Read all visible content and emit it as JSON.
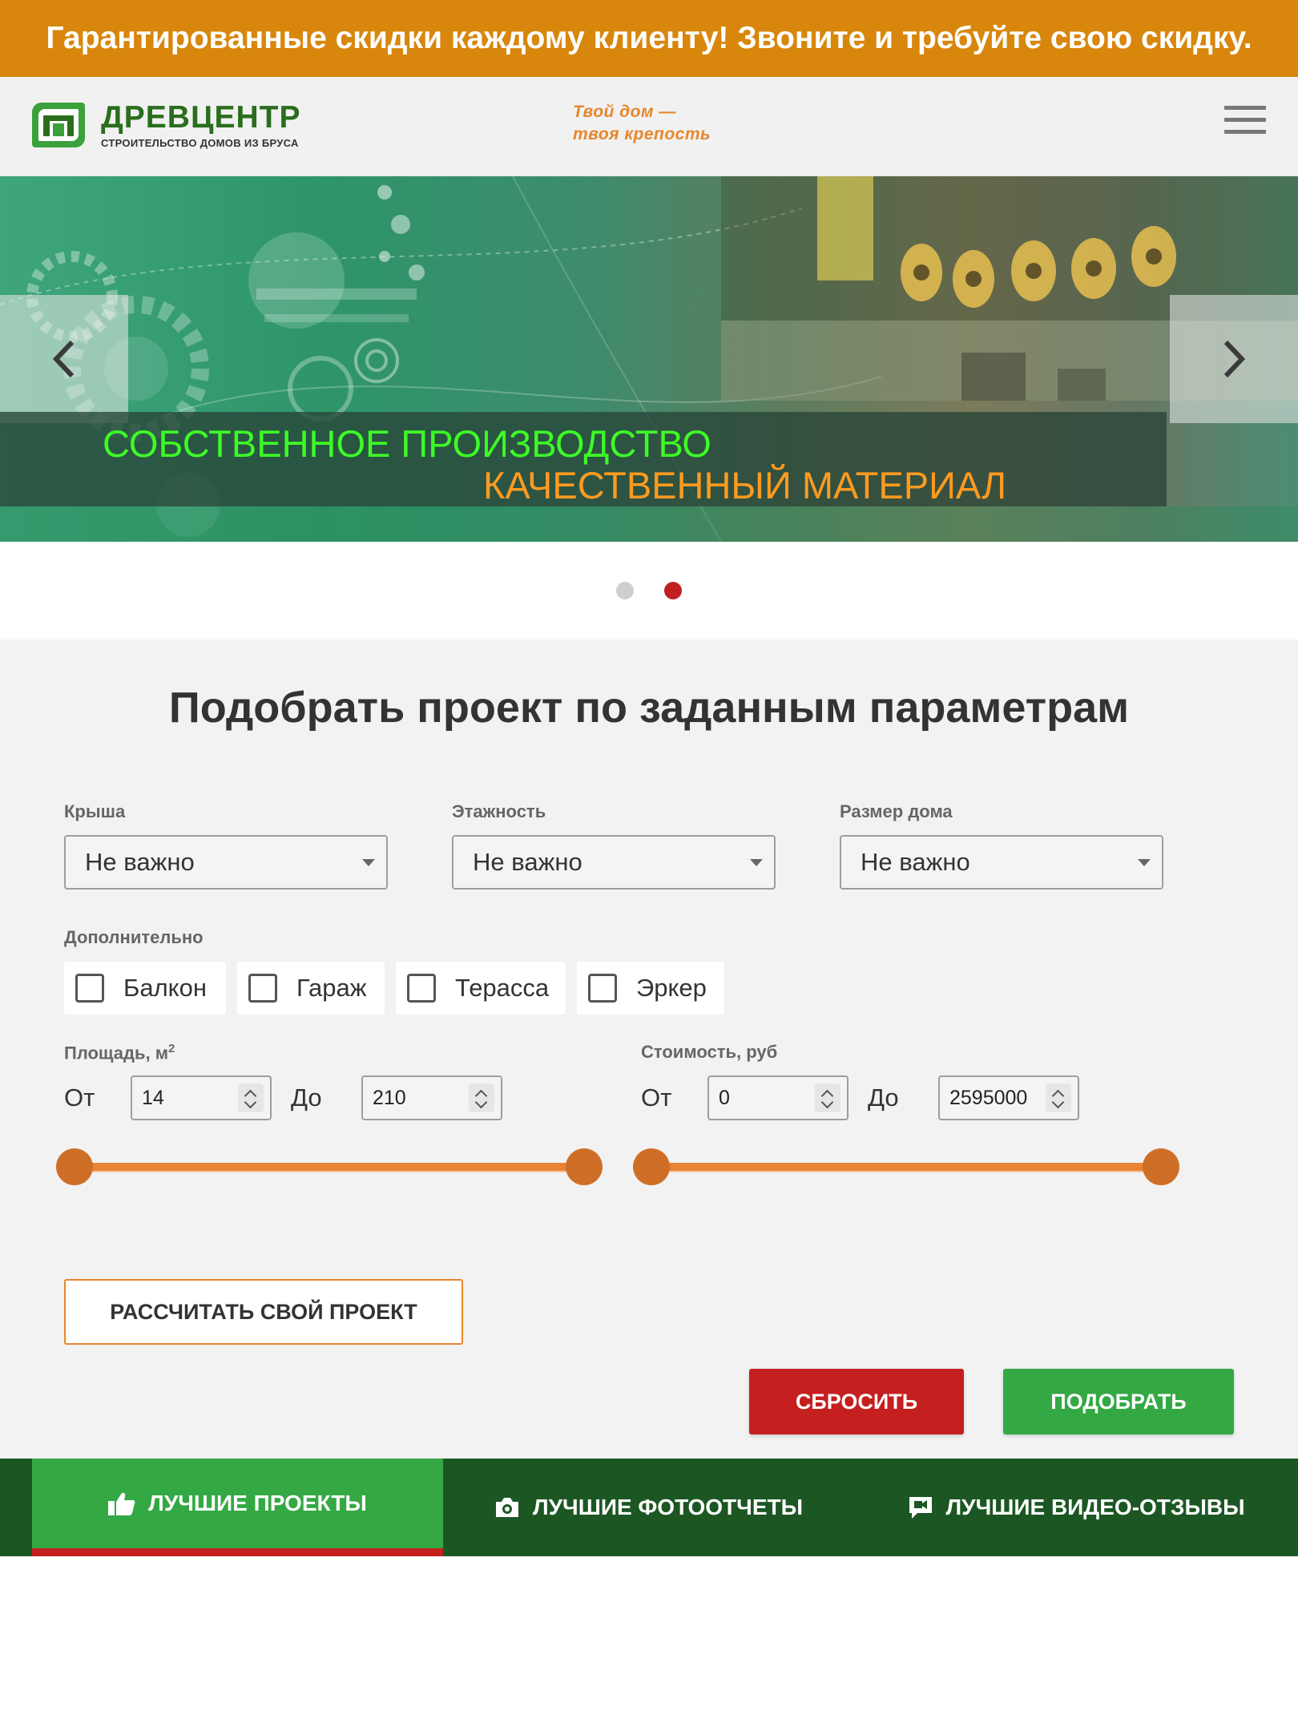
{
  "promo_bar": {
    "text": "Гарантированные скидки каждому клиенту! Звоните и требуйте свою скидку."
  },
  "header": {
    "logo_name": "ДРЕВЦЕНТР",
    "logo_sub": "СТРОИТЕЛЬСТВО ДОМОВ ИЗ БРУСА",
    "slogan_line1": "Твой дом —",
    "slogan_line2": "твоя крепость",
    "menu_icon": "hamburger-icon"
  },
  "slider": {
    "caption_line1": "СОБСТВЕННОЕ ПРОИЗВОДСТВО",
    "caption_line2": "КАЧЕСТВЕННЫЙ МАТЕРИАЛ",
    "prev_icon": "chevron-left-icon",
    "next_icon": "chevron-right-icon",
    "slide_count": 2,
    "active_slide": 2
  },
  "finder": {
    "title": "Подобрать проект по заданным параметрам",
    "selects": [
      {
        "label": "Крыша",
        "value": "Не важно"
      },
      {
        "label": "Этажность",
        "value": "Не важно"
      },
      {
        "label": "Размер дома",
        "value": "Не важно"
      }
    ],
    "extras_label": "Дополнительно",
    "checkboxes": [
      {
        "label": "Балкон",
        "checked": false
      },
      {
        "label": "Гараж",
        "checked": false
      },
      {
        "label": "Терасса",
        "checked": false
      },
      {
        "label": "Эркер",
        "checked": false
      }
    ],
    "area": {
      "label": "Площадь, м",
      "label_sup": "2",
      "from_label": "От",
      "to_label": "До",
      "from_value": "14",
      "to_value": "210",
      "range_low_fraction": 0,
      "range_high_fraction": 1
    },
    "price": {
      "label": "Стоимость, руб",
      "from_label": "От",
      "to_label": "До",
      "from_value": "0",
      "to_value": "2595000",
      "range_low_fraction": 0,
      "range_high_fraction": 1
    },
    "calc_button": "РАССЧИТАТЬ СВОЙ ПРОЕКТ",
    "reset_button": "СБРОСИТЬ",
    "submit_button": "ПОДОБРАТЬ"
  },
  "tabs": [
    {
      "label": "ЛУЧШИЕ ПРОЕКТЫ",
      "icon": "thumbs-up-icon",
      "active": true
    },
    {
      "label": "ЛУЧШИЕ ФОТООТЧЕТЫ",
      "icon": "camera-icon",
      "active": false
    },
    {
      "label": "ЛУЧШИЕ ВИДЕО-ОТЗЫВЫ",
      "icon": "video-camera-icon",
      "active": false
    }
  ],
  "colors": {
    "promo_bg": "#d8870c",
    "brand_green": "#2a6e1d",
    "accent_orange": "#e8862a",
    "reset_red": "#c51f20",
    "submit_green": "#34a843",
    "tabs_bg": "#1c5723"
  }
}
